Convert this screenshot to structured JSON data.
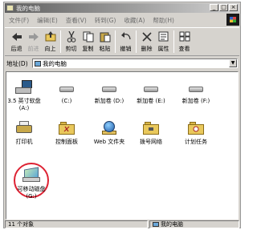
{
  "window": {
    "title": "我的电脑"
  },
  "menu": [
    "文件(F)",
    "编辑(E)",
    "查看(V)",
    "转到(G)",
    "收藏(A)",
    "帮助(H)"
  ],
  "toolbar": {
    "back": "后退",
    "forward": "前进",
    "up": "向上",
    "cut": "剪切",
    "copy": "复制",
    "paste": "粘贴",
    "undo": "撤销",
    "delete": "删除",
    "properties": "属性",
    "view": "查看"
  },
  "address": {
    "label": "地址(D)",
    "value": "我的电脑"
  },
  "drives": [
    {
      "label": "3.5 英寸软盘",
      "sublabel": "(A:)",
      "icon": "floppy-drive-icon"
    },
    {
      "label": "(C:)",
      "icon": "hard-drive-icon"
    },
    {
      "label": "新加卷 (D:)",
      "icon": "hard-drive-icon"
    },
    {
      "label": "新加卷 (E:)",
      "icon": "hard-drive-icon"
    },
    {
      "label": "新加卷 (F:)",
      "icon": "hard-drive-icon"
    }
  ],
  "system": [
    {
      "label": "打印机",
      "icon": "printer-icon"
    },
    {
      "label": "控制面板",
      "icon": "control-panel-icon"
    },
    {
      "label": "Web 文件夹",
      "icon": "web-folder-icon"
    },
    {
      "label": "拨号网络",
      "icon": "dialup-network-icon"
    },
    {
      "label": "计划任务",
      "icon": "scheduled-tasks-icon"
    }
  ],
  "removable": {
    "label": "可移动磁盘",
    "sublabel": "(G:)",
    "icon": "removable-disk-icon"
  },
  "status": {
    "count": "11 个对象",
    "location": "我的电脑"
  },
  "colors": {
    "highlight_circle": "#d22233",
    "titlebar_start": "#5f5f5f",
    "titlebar_end": "#d2d2d2"
  }
}
